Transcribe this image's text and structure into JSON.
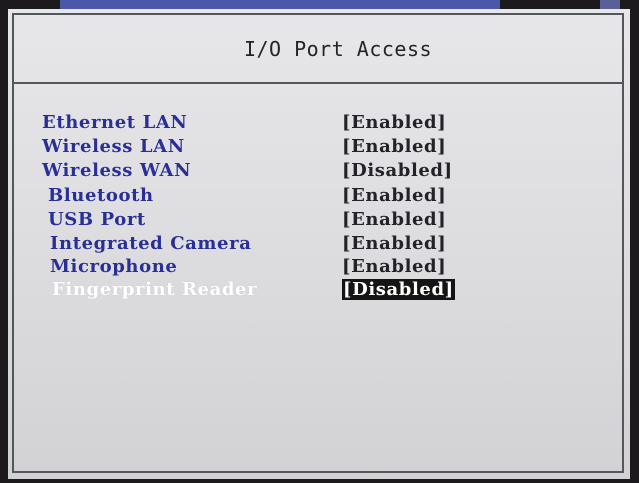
{
  "page": {
    "title": "I/O Port Access"
  },
  "settings": [
    {
      "label": "Ethernet LAN",
      "value": "[Enabled]"
    },
    {
      "label": "Wireless LAN",
      "value": "[Enabled]"
    },
    {
      "label": "Wireless WAN",
      "value": "[Disabled]"
    },
    {
      "label": "Bluetooth",
      "value": "[Enabled]"
    },
    {
      "label": "USB Port",
      "value": "[Enabled]"
    },
    {
      "label": "Integrated Camera",
      "value": "[Enabled]"
    },
    {
      "label": "Microphone",
      "value": "[Enabled]"
    },
    {
      "label": "Fingerprint Reader",
      "value": "Disabled",
      "selected_value_prefix": "[",
      "selected_value_suffix": "]"
    }
  ],
  "colors": {
    "label_blue": "#2a2f96",
    "screen_bg": "#e4e4e7",
    "selected_highlight": "#141414",
    "selected_text": "#ffffff"
  }
}
